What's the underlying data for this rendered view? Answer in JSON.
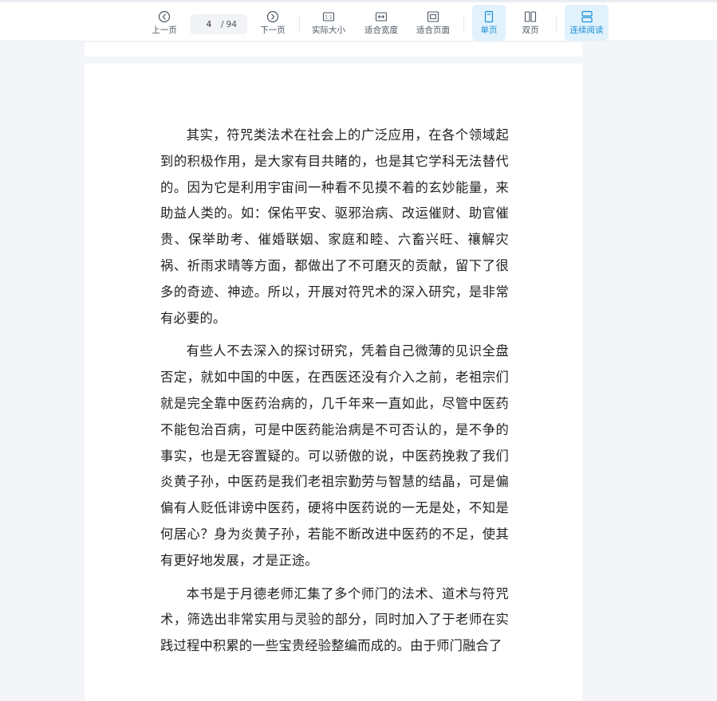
{
  "toolbar": {
    "prev_label": "上一页",
    "next_label": "下一页",
    "current_page": "4",
    "separator": "/",
    "total_pages": "94",
    "actual_size_label": "实际大小",
    "fit_width_label": "适合宽度",
    "fit_page_label": "适合页面",
    "single_page_label": "单页",
    "double_page_label": "双页",
    "continuous_label": "连续阅读",
    "active_color": "#1a8ed6",
    "active_bg": "#e2f2fc"
  },
  "content": {
    "paragraphs": [
      "其实，符咒类法术在社会上的广泛应用，在各个领域起到的积极作用，是大家有目共睹的，也是其它学科无法替代的。因为它是利用宇宙间一种看不见摸不着的玄妙能量，来助益人类的。如：保佑平安、驱邪治病、改运催财、助官催贵、保举助考、催婚联姻、家庭和睦、六畜兴旺、禳解灾祸、祈雨求晴等方面，都做出了不可磨灭的贡献，留下了很多的奇迹、神迹。所以，开展对符咒术的深入研究，是非常有必要的。",
      "有些人不去深入的探讨研究，凭着自己微薄的见识全盘否定，就如中国的中医，在西医还没有介入之前，老祖宗们就是完全靠中医药治病的，几千年来一直如此，尽管中医药不能包治百病，可是中医药能治病是不可否认的，是不争的事实，也是无容置疑的。可以骄傲的说，中医药挽救了我们炎黄子孙，中医药是我们老祖宗勤劳与智慧的结晶，可是偏偏有人贬低诽谤中医药，硬将中医药说的一无是处，不知是何居心？身为炎黄子孙，若能不断改进中医药的不足，使其有更好地发展，才是正途。",
      "本书是于月德老师汇集了多个师门的法术、道术与符咒术，筛选出非常实用与灵验的部分，同时加入了于老师在实践过程中积累的一些宝贵经验整编而成的。由于师门融合了"
    ]
  }
}
